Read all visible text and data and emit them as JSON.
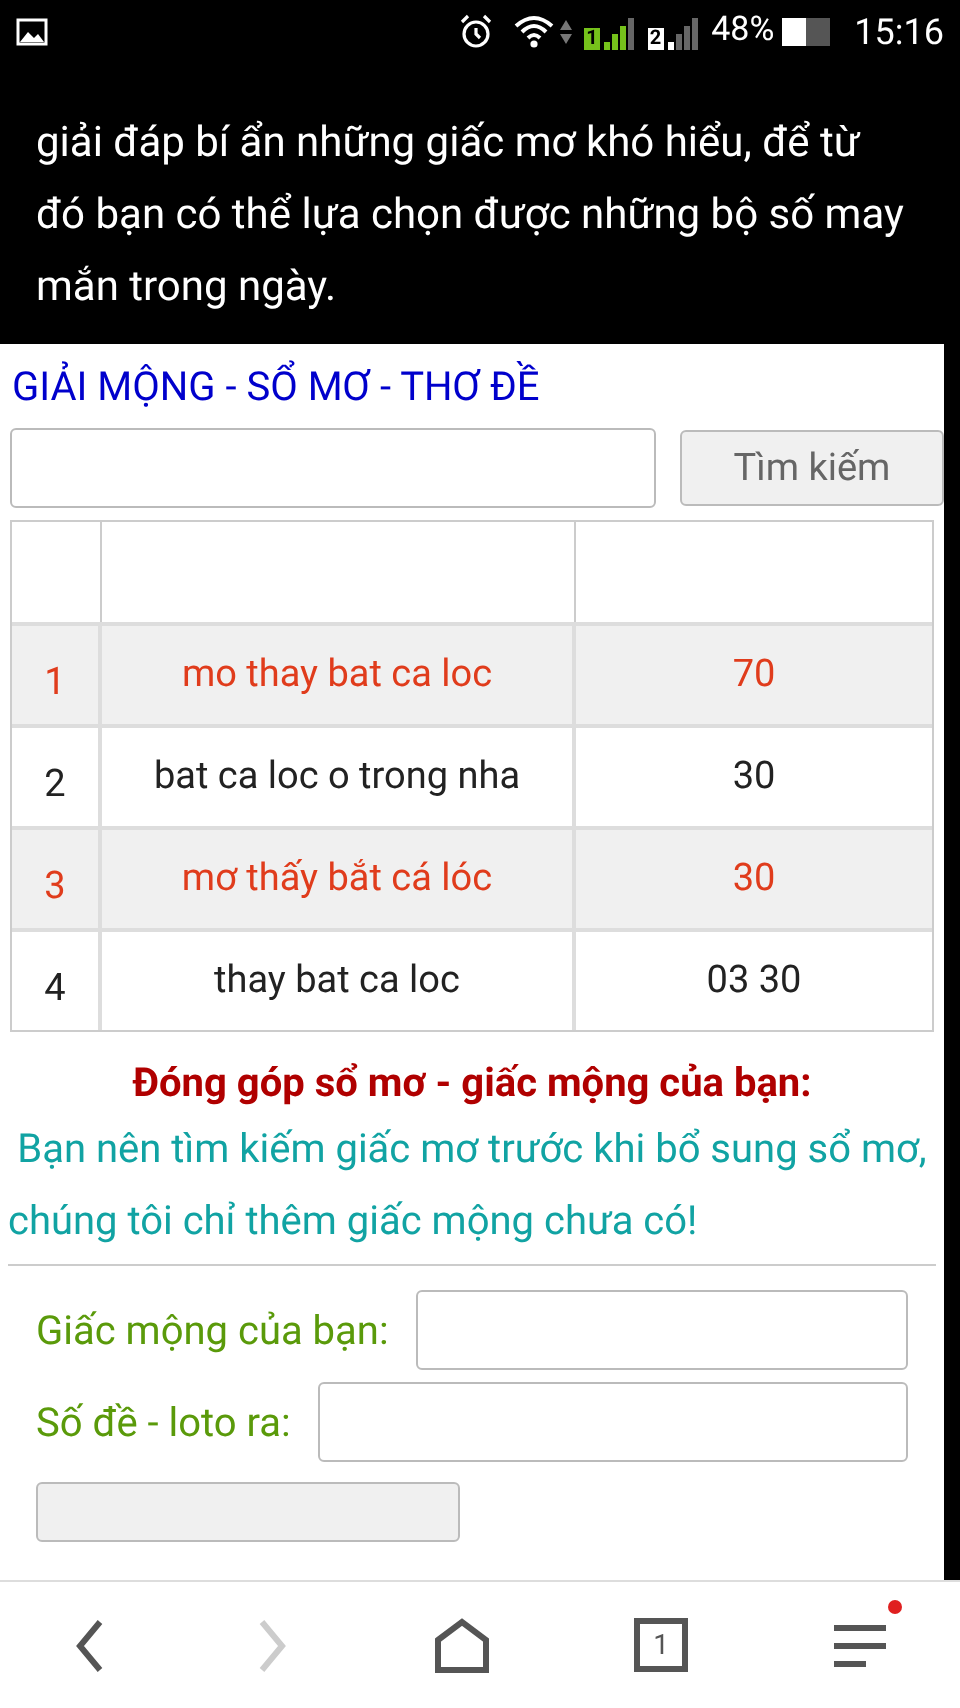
{
  "status_bar": {
    "sims": [
      {
        "label": "1",
        "active": true
      },
      {
        "label": "2",
        "active": false
      }
    ],
    "battery": "48%",
    "time": "15:16"
  },
  "intro": "giải đáp bí ẩn những giấc mơ khó hiểu, để từ đó bạn có thể lựa chọn được những bộ số may mắn trong ngày.",
  "title": "GIẢI MỘNG - SỔ MƠ - THƠ ĐỀ",
  "search": {
    "button": "Tìm kiếm"
  },
  "table": {
    "rows": [
      {
        "index": "1",
        "dream": "mo thay bat ca loc",
        "numbers": "70",
        "highlighted": true
      },
      {
        "index": "2",
        "dream": "bat ca loc o trong nha",
        "numbers": "30",
        "highlighted": false
      },
      {
        "index": "3",
        "dream": "mơ thấy bắt cá lóc",
        "numbers": "30",
        "highlighted": true
      },
      {
        "index": "4",
        "dream": "thay bat ca loc",
        "numbers": "03 30",
        "highlighted": false
      }
    ]
  },
  "contribute": {
    "heading": "Đóng góp sổ mơ - giấc mộng của bạn:",
    "note": "Bạn nên tìm kiếm giấc mơ trước khi bổ sung sổ mơ, chúng tôi chỉ thêm giấc mộng chưa có!"
  },
  "form": {
    "fields": [
      {
        "label": "Giấc mộng của bạn:"
      },
      {
        "label": "Số đề - loto ra:"
      }
    ]
  },
  "nav": {
    "forward_enabled": false,
    "tab_count": "1",
    "menu_badge": true
  }
}
